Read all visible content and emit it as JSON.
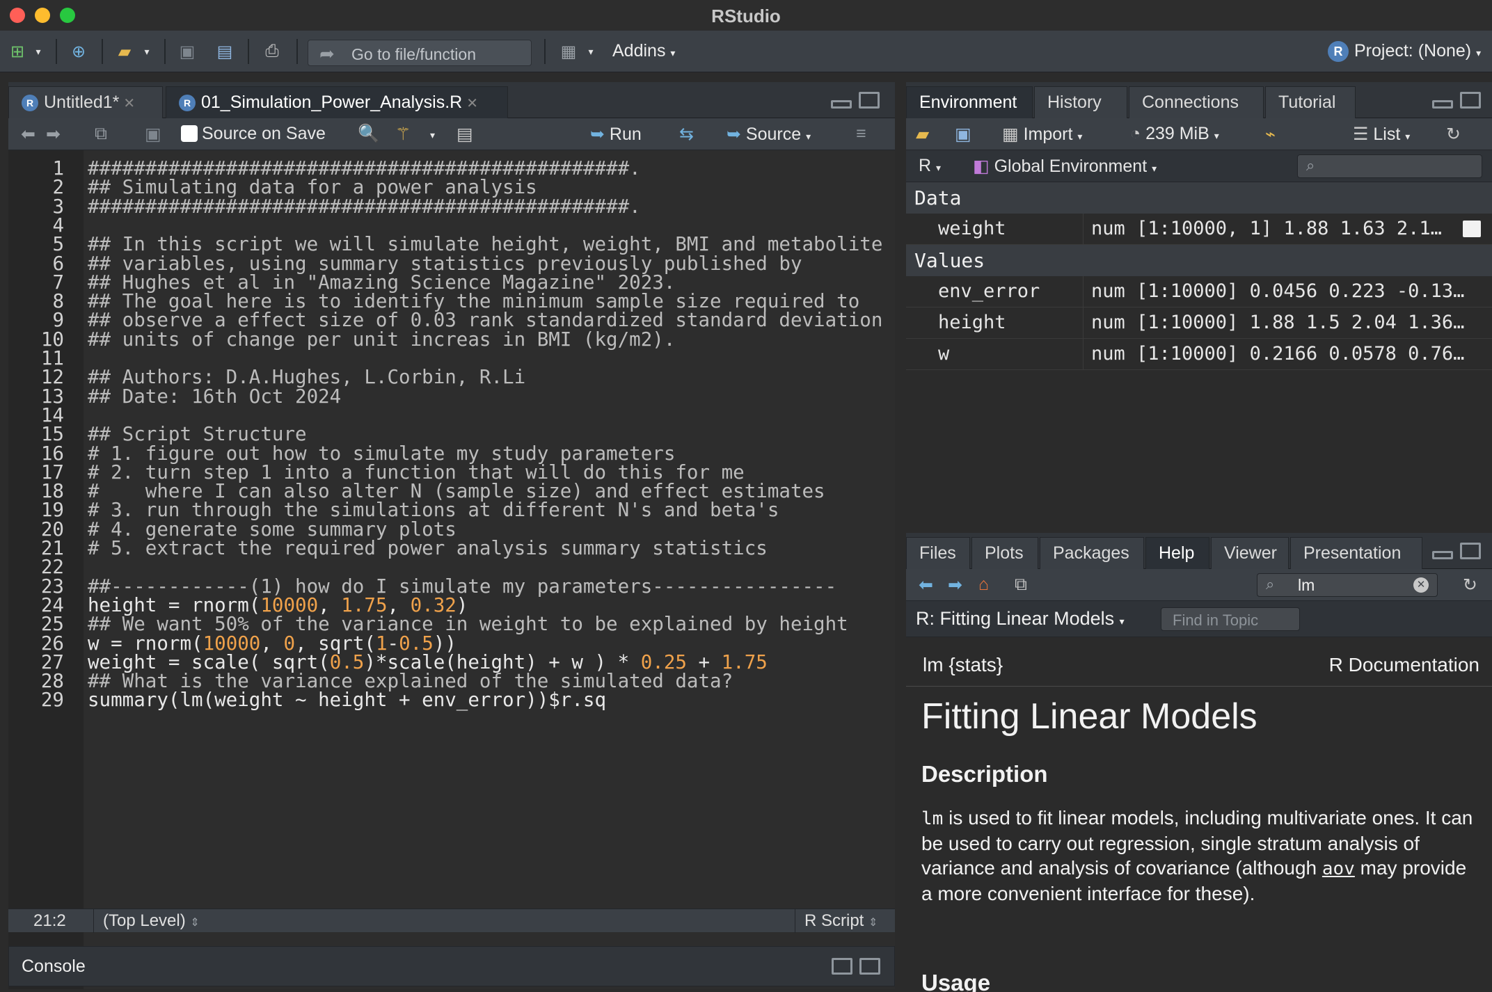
{
  "window": {
    "title": "RStudio"
  },
  "toolbar": {
    "goto_placeholder": "Go to file/function",
    "addins": "Addins",
    "project": "Project: (None)"
  },
  "editor": {
    "tabs": [
      {
        "label": "Untitled1*"
      },
      {
        "label": "01_Simulation_Power_Analysis.R"
      }
    ],
    "source_on_save": "Source on Save",
    "run": "Run",
    "source": "Source",
    "lines": [
      "###############################################.",
      "## Simulating data for a power analysis",
      "###############################################.",
      "",
      "## In this script we will simulate height, weight, BMI and metabolite",
      "## variables, using summary statistics previously published by",
      "## Hughes et al in \"Amazing Science Magazine\" 2023.",
      "## The goal here is to identify the minimum sample size required to",
      "## observe a effect size of 0.03 rank standardized standard deviation",
      "## units of change per unit increas in BMI (kg/m2).",
      "",
      "## Authors: D.A.Hughes, L.Corbin, R.Li",
      "## Date: 16th Oct 2024",
      "",
      "## Script Structure",
      "# 1. figure out how to simulate my study parameters",
      "# 2. turn step 1 into a function that will do this for me",
      "#    where I can also alter N (sample size) and effect estimates",
      "# 3. run through the simulations at different N's and beta's",
      "# 4. generate some summary plots",
      "# 5. extract the required power analysis summary statistics",
      "",
      "##------------(1) how do I simulate my parameters----------------",
      "height = rnorm(10000, 1.75, 0.32)",
      "## We want 50% of the variance in weight to be explained by height",
      "w = rnorm(10000, 0, sqrt(1-0.5))",
      "weight = scale( sqrt(0.5)*scale(height) + w ) * 0.25 + 1.75",
      "## What is the variance explained of the simulated data?",
      "summary(lm(weight ~ height + env_error))$r.sq"
    ],
    "status": {
      "position": "21:2",
      "scope": "(Top Level)",
      "filetype": "R Script"
    }
  },
  "console": {
    "label": "Console"
  },
  "environment": {
    "tabs": [
      "Environment",
      "History",
      "Connections",
      "Tutorial"
    ],
    "import": "Import",
    "memory": "239 MiB",
    "view": "List",
    "lang": "R",
    "scope": "Global Environment",
    "sections": [
      {
        "title": "Data",
        "rows": [
          {
            "name": "weight",
            "value": "num [1:10000, 1] 1.88 1.63 2.1…"
          }
        ]
      },
      {
        "title": "Values",
        "rows": [
          {
            "name": "env_error",
            "value": "num [1:10000] 0.0456 0.223 -0.13…"
          },
          {
            "name": "height",
            "value": "num [1:10000] 1.88 1.5 2.04 1.36…"
          },
          {
            "name": "w",
            "value": "num [1:10000] 0.2166 0.0578 0.76…"
          }
        ]
      }
    ]
  },
  "help": {
    "tabs": [
      "Files",
      "Plots",
      "Packages",
      "Help",
      "Viewer",
      "Presentation"
    ],
    "search_value": "lm",
    "topic": "R: Fitting Linear Models",
    "find_placeholder": "Find in Topic",
    "doc": {
      "left_header": "lm {stats}",
      "right_header": "R Documentation",
      "title": "Fitting Linear Models",
      "description_heading": "Description",
      "desc_code": "lm",
      "desc_1": " is used to fit linear models, including multivariate ones. It can be used to carry out regression, single stratum analysis of variance and analysis of covariance (although ",
      "desc_link": "aov",
      "desc_2": " may provide a more convenient interface for these).",
      "usage_heading": "Usage"
    }
  }
}
